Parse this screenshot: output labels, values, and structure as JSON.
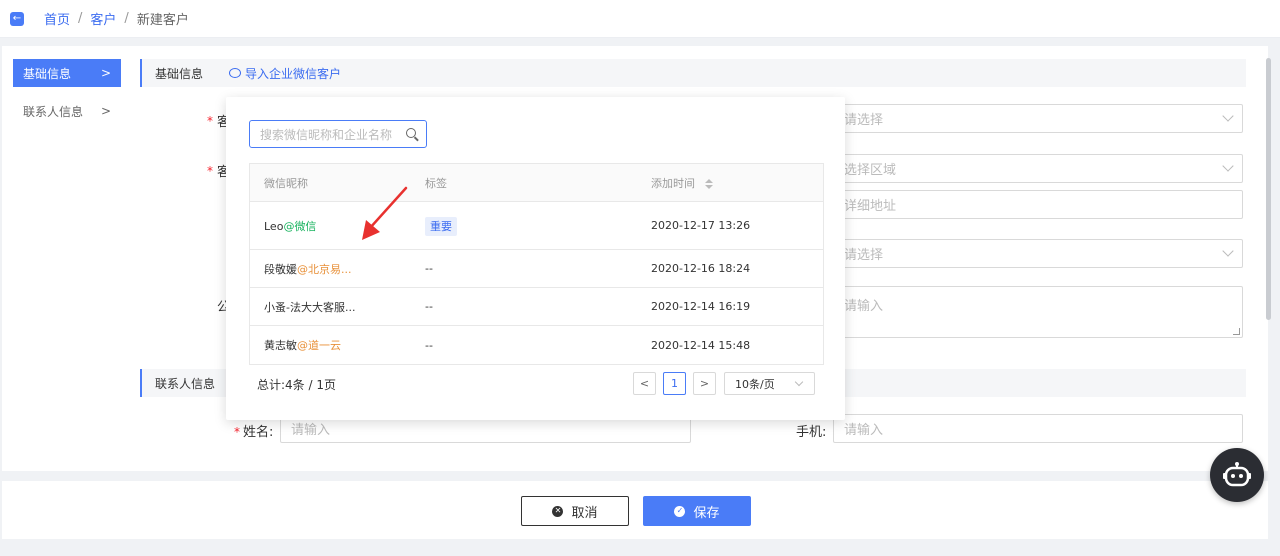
{
  "breadcrumb": {
    "home": "首页",
    "customers": "客户",
    "current": "新建客户",
    "sep": "/"
  },
  "sidebar": {
    "items": [
      {
        "label": "基础信息",
        "active": true
      },
      {
        "label": "联系人信息",
        "active": false
      }
    ]
  },
  "section_basic": {
    "title": "基础信息",
    "import_link": "导入企业微信客户"
  },
  "section_contact": {
    "title": "联系人信息"
  },
  "form": {
    "placeholder_select": "请选择",
    "placeholder_region": "选择区域",
    "placeholder_address": "详细地址",
    "placeholder_select2": "请选择",
    "placeholder_textarea": "请输入",
    "name_label": "姓名:",
    "name_placeholder": "请输入",
    "phone_label": "手机:",
    "phone_placeholder": "请输入",
    "partial_label_1": "客",
    "partial_label_2": "客",
    "partial_label_3": "公"
  },
  "popup": {
    "search_placeholder": "搜索微信昵称和企业名称",
    "columns": {
      "nickname": "微信昵称",
      "tag": "标签",
      "added_time": "添加时间"
    },
    "rows": [
      {
        "name": "Leo",
        "suffix": "@微信",
        "tag": "重要",
        "time": "2020-12-17 13:26"
      },
      {
        "name": "段敬媛",
        "suffix": "@北京易...",
        "tag": "--",
        "time": "2020-12-16 18:24"
      },
      {
        "name": "小蚤-法大大客服...",
        "suffix": "",
        "tag": "--",
        "time": "2020-12-14 16:19"
      },
      {
        "name": "黄志敏",
        "suffix": "@道一云",
        "tag": "--",
        "time": "2020-12-14 15:48"
      }
    ],
    "pager": {
      "total": "总计:4条 / 1页",
      "prev": "<",
      "page": "1",
      "next": ">",
      "size": "10条/页"
    }
  },
  "footer": {
    "cancel": "取消",
    "save": "保存"
  },
  "colors": {
    "primary": "#4a7cf7",
    "danger": "#f5222d",
    "green": "#19b35f",
    "orange": "#e8913a",
    "arrow_red": "#e8312f"
  }
}
